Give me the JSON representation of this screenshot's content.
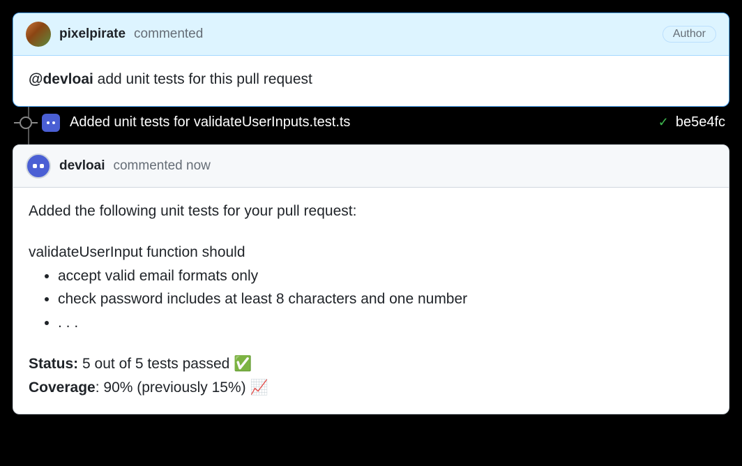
{
  "comment1": {
    "username": "pixelpirate",
    "action": "commented",
    "badge": "Author",
    "mention": "@devloai",
    "body_rest": " add unit tests for this pull request"
  },
  "commit": {
    "message": "Added unit tests for validateUserInputs.test.ts",
    "hash": "be5e4fc"
  },
  "comment2": {
    "username": "devloai",
    "action": "commented now",
    "intro": "Added the following unit tests for your pull request:",
    "subhead": "validateUserInput function should",
    "tests": [
      "accept valid email formats only",
      "check password includes at least 8 characters and one number",
      ". . ."
    ],
    "status_label": "Status:",
    "status_value": " 5 out of 5 tests passed ✅",
    "coverage_label": "Coverage",
    "coverage_value": ": 90% (previously 15%) 📈"
  }
}
